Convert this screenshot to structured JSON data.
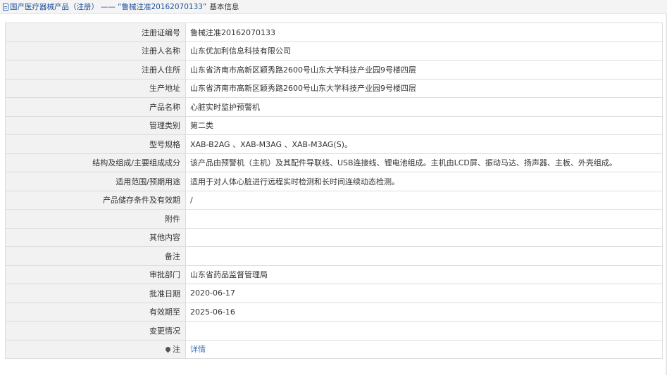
{
  "breadcrumb": {
    "root": "国产医疗器械产品（注册）",
    "separator": "——",
    "record": "“鲁械注准20162070133”",
    "current": "基本信息"
  },
  "rows": [
    {
      "label": "注册证编号",
      "value": "鲁械注准20162070133"
    },
    {
      "label": "注册人名称",
      "value": "山东优加利信息科技有限公司"
    },
    {
      "label": "注册人住所",
      "value": "山东省济南市高新区颖秀路2600号山东大学科技产业园9号楼四层"
    },
    {
      "label": "生产地址",
      "value": "山东省济南市高新区颖秀路2600号山东大学科技产业园9号楼四层"
    },
    {
      "label": "产品名称",
      "value": "心脏实时监护预警机"
    },
    {
      "label": "管理类别",
      "value": "第二类"
    },
    {
      "label": "型号规格",
      "value": "XAB-B2AG 、XAB-M3AG 、XAB-M3AG(S)。"
    },
    {
      "label": "结构及组成/主要组成成分",
      "value": "该产品由预警机（主机）及其配件导联线、USB连接线、锂电池组成。主机由LCD屏、振动马达、扬声器、主板、外壳组成。"
    },
    {
      "label": "适用范围/预期用途",
      "value": "适用于对人体心脏进行远程实时检测和长时间连续动态检测。"
    },
    {
      "label": "产品储存条件及有效期",
      "value": "/"
    },
    {
      "label": "附件",
      "value": ""
    },
    {
      "label": "其他内容",
      "value": ""
    },
    {
      "label": "备注",
      "value": ""
    },
    {
      "label": "审批部门",
      "value": "山东省药品监督管理局"
    },
    {
      "label": "批准日期",
      "value": "2020-06-17"
    },
    {
      "label": "有效期至",
      "value": "2025-06-16"
    },
    {
      "label": "变更情况",
      "value": ""
    }
  ],
  "note": {
    "label": "注",
    "icon": "pin-icon",
    "link_text": "详情"
  }
}
